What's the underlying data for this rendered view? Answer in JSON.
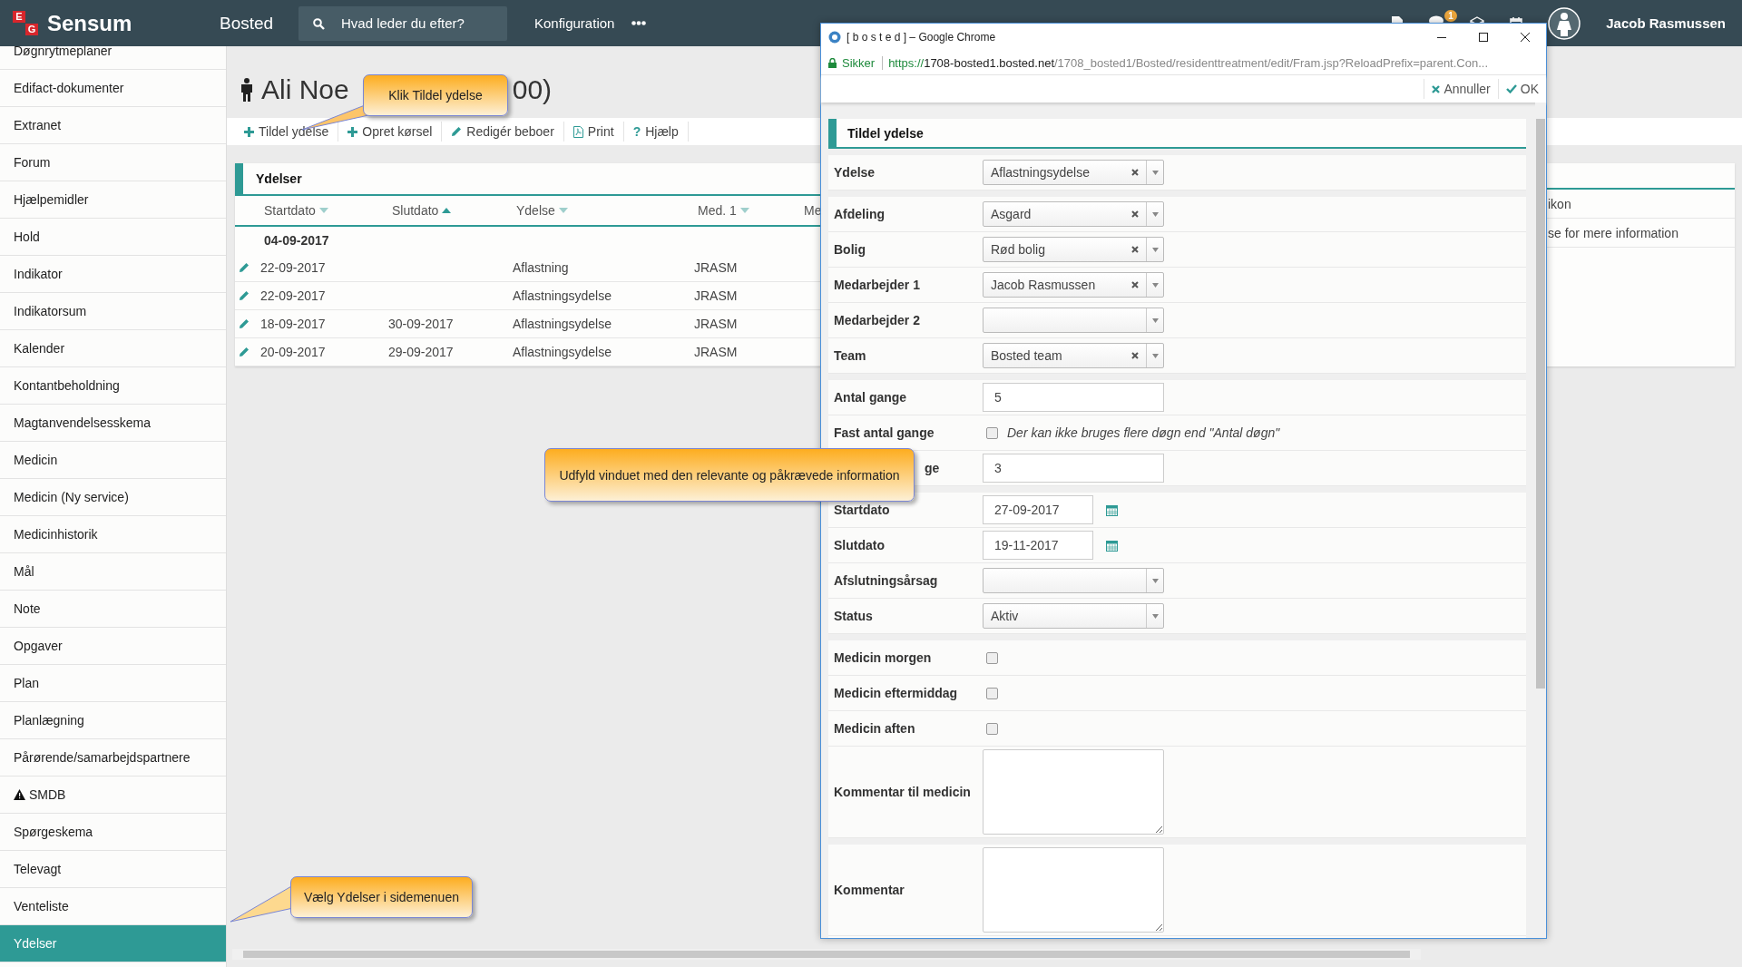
{
  "topbar": {
    "logo_letters": [
      "E",
      "G"
    ],
    "brand": "Sensum",
    "module": "Bosted",
    "search": {
      "placeholder": "Hvad leder du efter?"
    },
    "menu": "Konfiguration",
    "notification_badge": "1",
    "user": "Jacob Rasmussen"
  },
  "sidebar": {
    "items": [
      {
        "label": "Døgnrytmeplaner",
        "selected": false,
        "warning": false
      },
      {
        "label": "Edifact-dokumenter",
        "selected": false,
        "warning": false
      },
      {
        "label": "Extranet",
        "selected": false,
        "warning": false
      },
      {
        "label": "Forum",
        "selected": false,
        "warning": false
      },
      {
        "label": "Hjælpemidler",
        "selected": false,
        "warning": false
      },
      {
        "label": "Hold",
        "selected": false,
        "warning": false
      },
      {
        "label": "Indikator",
        "selected": false,
        "warning": false
      },
      {
        "label": "Indikatorsum",
        "selected": false,
        "warning": false
      },
      {
        "label": "Kalender",
        "selected": false,
        "warning": false
      },
      {
        "label": "Kontantbeholdning",
        "selected": false,
        "warning": false
      },
      {
        "label": "Magtanvendelsesskema",
        "selected": false,
        "warning": false
      },
      {
        "label": "Medicin",
        "selected": false,
        "warning": false
      },
      {
        "label": "Medicin (Ny service)",
        "selected": false,
        "warning": false
      },
      {
        "label": "Medicinhistorik",
        "selected": false,
        "warning": false
      },
      {
        "label": "Mål",
        "selected": false,
        "warning": false
      },
      {
        "label": "Note",
        "selected": false,
        "warning": false
      },
      {
        "label": "Opgaver",
        "selected": false,
        "warning": false
      },
      {
        "label": "Plan",
        "selected": false,
        "warning": false
      },
      {
        "label": "Planlægning",
        "selected": false,
        "warning": false
      },
      {
        "label": "Pårørende/samarbejdspartnere",
        "selected": false,
        "warning": false
      },
      {
        "label": "SMDB",
        "selected": false,
        "warning": true
      },
      {
        "label": "Spørgeskema",
        "selected": false,
        "warning": false
      },
      {
        "label": "Televagt",
        "selected": false,
        "warning": false
      },
      {
        "label": "Venteliste",
        "selected": false,
        "warning": false
      },
      {
        "label": "Ydelser",
        "selected": true,
        "warning": false
      }
    ]
  },
  "resident": {
    "title_start": "Ali Noe",
    "title_end": "00)"
  },
  "toolbar": [
    {
      "kind": "add",
      "label": "Tildel ydelse"
    },
    {
      "kind": "add",
      "label": "Opret kørsel"
    },
    {
      "kind": "edit",
      "label": "Redigér beboer"
    },
    {
      "kind": "print",
      "label": "Print"
    },
    {
      "kind": "help",
      "glyph": "?",
      "label": "Hjælp"
    }
  ],
  "ydelser": {
    "title": "Ydelser",
    "columns": [
      {
        "label": "Startdato",
        "sorted": false
      },
      {
        "label": "Slutdato",
        "sorted": true
      },
      {
        "label": "Ydelse",
        "sorted": false
      },
      {
        "label": "Med. 1",
        "sorted": false
      },
      {
        "label": "Me"
      }
    ],
    "groups": [
      {
        "label": "04-09-2017",
        "rows": [
          {
            "cells": [
              "22-09-2017",
              "",
              "Aflastning",
              "JRASM"
            ]
          },
          {
            "cells": [
              "22-09-2017",
              "",
              "Aflastningsydelse",
              "JRASM"
            ]
          },
          {
            "cells": [
              "18-09-2017",
              "30-09-2017",
              "Aflastningsydelse",
              "JRASM"
            ]
          },
          {
            "cells": [
              "20-09-2017",
              "29-09-2017",
              "Aflastningsydelse",
              "JRASM"
            ]
          }
        ]
      }
    ]
  },
  "side_panel": {
    "lines": [
      "ikon",
      "se for mere information"
    ]
  },
  "popup": {
    "title": "[ b o s t e d ] – Google Chrome",
    "secure_label": "Sikker",
    "url": {
      "scheme": "https://",
      "host": "1708-bosted1.bosted.net",
      "path": "/1708_bosted1/Bosted/residenttreatment/edit/Fram.jsp?ReloadPrefix=parent.Con..."
    },
    "actions": [
      {
        "kind": "cancel",
        "label": "Annuller"
      },
      {
        "kind": "ok",
        "label": "OK"
      }
    ],
    "form": {
      "title": "Tildel ydelse",
      "sections": [
        {
          "rows": [
            {
              "kind": "select",
              "label": "Ydelse",
              "value": "Aflastningsydelse",
              "clearable": true
            }
          ]
        },
        {
          "rows": [
            {
              "kind": "select",
              "label": "Afdeling",
              "value": "Asgard",
              "clearable": true
            },
            {
              "kind": "select",
              "label": "Bolig",
              "value": "Rød bolig",
              "clearable": true
            },
            {
              "kind": "select",
              "label": "Medarbejder 1",
              "value": "Jacob Rasmussen",
              "clearable": true
            },
            {
              "kind": "select",
              "label": "Medarbejder 2",
              "clearable": false
            },
            {
              "kind": "select",
              "label": "Team",
              "value": "Bosted team",
              "clearable": true
            }
          ]
        },
        {
          "rows": [
            {
              "kind": "input",
              "label": "Antal gange",
              "value": "5"
            },
            {
              "kind": "checkbox",
              "label": "Fast antal gange",
              "checked": false,
              "hint": "Der kan ikke bruges flere døgn end \"Antal døgn\""
            },
            {
              "kind": "input",
              "label": "ge",
              "label_covered": true,
              "value": "3"
            }
          ]
        },
        {
          "rows": [
            {
              "kind": "date",
              "label": "Startdato",
              "value": "27-09-2017"
            },
            {
              "kind": "date",
              "label": "Slutdato",
              "value": "19-11-2017"
            },
            {
              "kind": "select",
              "label": "Afslutningsårsag",
              "clearable": false
            },
            {
              "kind": "select",
              "label": "Status",
              "value": "Aktiv",
              "clearable": false
            }
          ]
        },
        {
          "rows": [
            {
              "kind": "checkbox",
              "label": "Medicin morgen",
              "checked": false
            },
            {
              "kind": "checkbox",
              "label": "Medicin eftermiddag",
              "checked": false
            },
            {
              "kind": "checkbox",
              "label": "Medicin aften",
              "checked": false
            },
            {
              "kind": "textarea",
              "label": "Kommentar til medicin"
            }
          ]
        },
        {
          "rows": [
            {
              "kind": "textarea",
              "label": "Kommentar"
            }
          ]
        }
      ]
    }
  },
  "callouts": [
    {
      "text": "Klik Tildel ydelse"
    },
    {
      "text": "Udfyld vinduet med den relevante og påkrævede information"
    },
    {
      "text": "Vælg Ydelser i sidemenuen"
    }
  ]
}
